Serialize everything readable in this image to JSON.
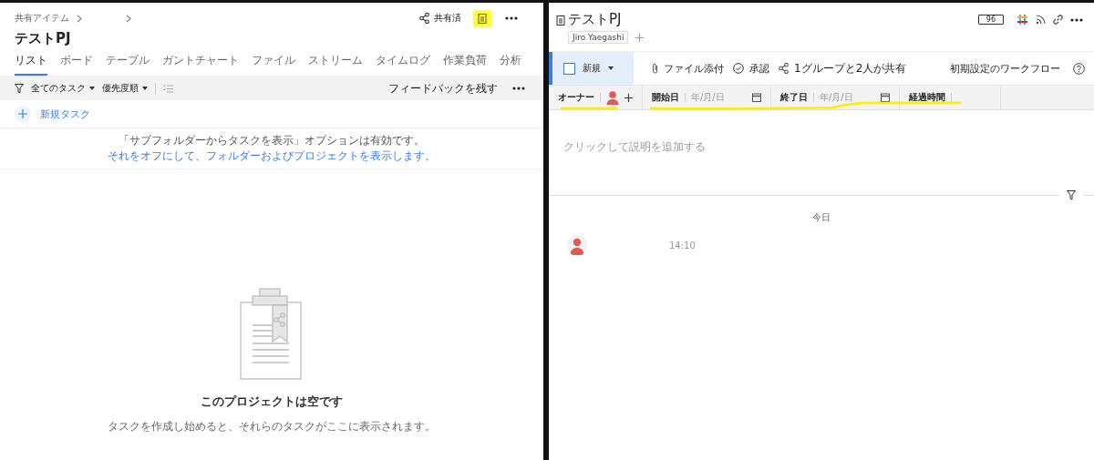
{
  "left": {
    "breadcrumb": [
      {
        "label": "共有アイテム"
      }
    ],
    "title": "テストPJ",
    "share_label": "共有済",
    "tabs": [
      {
        "label": "リスト",
        "selected": true
      },
      {
        "label": "ボード",
        "selected": false
      },
      {
        "label": "テーブル",
        "selected": false
      },
      {
        "label": "ガントチャート",
        "selected": false
      },
      {
        "label": "ファイル",
        "selected": false
      },
      {
        "label": "ストリーム",
        "selected": false
      },
      {
        "label": "タイムログ",
        "selected": false
      },
      {
        "label": "作業負荷",
        "selected": false
      },
      {
        "label": "分析",
        "selected": false
      }
    ],
    "toolbar": {
      "filter": "全てのタスク",
      "sort": "優先度順",
      "feedback": "フィードバックを残す"
    },
    "new_task": "新規タスク",
    "notice": {
      "text": "「サブフォルダーからタスクを表示」オプションは有効です。",
      "link": "それをオフにして、フォルダーおよびプロジェクトを表示します。"
    },
    "empty": {
      "title": "このプロジェクトは空です",
      "subtitle": "タスクを作成し始めると、それらのタスクがここに表示されます。"
    }
  },
  "right": {
    "title": "テストPJ",
    "tags": [
      "Jiro Yaegashi"
    ],
    "count_badge": "96",
    "toolbar": {
      "new": "新規",
      "attach": "ファイル添付",
      "approve": "承認",
      "share": "1グループと2人が共有",
      "workflow": "初期設定のワークフロー"
    },
    "fields": [
      {
        "kind": "owner",
        "label": "オーナー"
      },
      {
        "kind": "date",
        "label": "開始日",
        "placeholder": "年/月/日"
      },
      {
        "kind": "date",
        "label": "終了日",
        "placeholder": "年/月/日"
      },
      {
        "kind": "text",
        "label": "経過時間"
      }
    ],
    "description_placeholder": "クリックして説明を追加する",
    "stream": {
      "day": "今日",
      "entries": [
        {
          "time": "14:10"
        }
      ]
    }
  }
}
